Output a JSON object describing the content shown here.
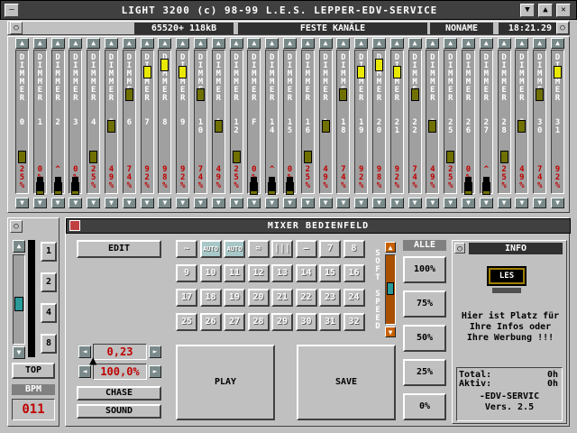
{
  "window": {
    "title": "LIGHT 3200 (c) 98-99 L.E.S. LEPPER-EDV-SERVICE",
    "menu_icon": "dash-icon",
    "btn_min": "▼",
    "btn_max": "▲",
    "btn_close": "✕"
  },
  "status": {
    "memory": "65520+ 118kB",
    "mode": "FESTE KANÄLE",
    "file": "NONAME",
    "time": "18:21.29"
  },
  "dimmer": {
    "label": "DIMMER",
    "up_arrow": "▲",
    "down_arrow": "▼",
    "channels": [
      {
        "num": "0",
        "pct": "25%",
        "level": 0.25
      },
      {
        "num": "1",
        "pct": "0%",
        "level": 0.0
      },
      {
        "num": "2",
        "pct": "^",
        "level": 0.0
      },
      {
        "num": "3",
        "pct": "0%",
        "level": 0.0
      },
      {
        "num": "4",
        "pct": "25%",
        "level": 0.25
      },
      {
        "num": "5",
        "pct": "49%",
        "level": 0.49
      },
      {
        "num": "6",
        "pct": "74%",
        "level": 0.74
      },
      {
        "num": "7",
        "pct": "92%",
        "level": 0.92
      },
      {
        "num": "8",
        "pct": "98%",
        "level": 0.98
      },
      {
        "num": "9",
        "pct": "92%",
        "level": 0.92
      },
      {
        "num": "10",
        "pct": "74%",
        "level": 0.74
      },
      {
        "num": "11",
        "pct": "49%",
        "level": 0.49
      },
      {
        "num": "12",
        "pct": "25%",
        "level": 0.25
      },
      {
        "num": "F",
        "pct": "0%",
        "level": 0.0
      },
      {
        "num": "14",
        "pct": "^",
        "level": 0.0
      },
      {
        "num": "15",
        "pct": "0%",
        "level": 0.0
      },
      {
        "num": "16",
        "pct": "25%",
        "level": 0.25
      },
      {
        "num": "17",
        "pct": "49%",
        "level": 0.49
      },
      {
        "num": "18",
        "pct": "74%",
        "level": 0.74
      },
      {
        "num": "19",
        "pct": "92%",
        "level": 0.92
      },
      {
        "num": "20",
        "pct": "98%",
        "level": 0.98
      },
      {
        "num": "21",
        "pct": "92%",
        "level": 0.92
      },
      {
        "num": "22",
        "pct": "74%",
        "level": 0.74
      },
      {
        "num": "24",
        "pct": "49%",
        "level": 0.49
      },
      {
        "num": "25",
        "pct": "25%",
        "level": 0.25
      },
      {
        "num": "26",
        "pct": "0%",
        "level": 0.0
      },
      {
        "num": "27",
        "pct": "^",
        "level": 0.0
      },
      {
        "num": "28",
        "pct": "25%",
        "level": 0.25
      },
      {
        "num": "29",
        "pct": "49%",
        "level": 0.49
      },
      {
        "num": "30",
        "pct": "74%",
        "level": 0.74
      },
      {
        "num": "31",
        "pct": "92%",
        "level": 0.92
      }
    ]
  },
  "left": {
    "pages": [
      "1",
      "2",
      "4",
      "8"
    ],
    "top_label": "TOP",
    "bpm_label": "BPM",
    "bpm_value": "011"
  },
  "mixer": {
    "title": "MIXER BEDIENFELD",
    "edit": "EDIT",
    "rate_value": "0,23",
    "percent_value": "100,0%",
    "chase": "CHASE",
    "sound": "SOUND",
    "play": "PLAY",
    "save": "SAVE",
    "soft": "SOFT",
    "speed": "SPEED",
    "alle": "ALLE",
    "presets": [
      "100%",
      "75%",
      "50%",
      "25%",
      "0%"
    ],
    "pattern_row1": [
      "~",
      "AUTO",
      "AUTO",
      "≈",
      "|||",
      "—",
      "7",
      "8"
    ],
    "grid": [
      "9",
      "10",
      "11",
      "12",
      "13",
      "14",
      "15",
      "16",
      "17",
      "18",
      "19",
      "20",
      "21",
      "22",
      "23",
      "24",
      "25",
      "26",
      "27",
      "28",
      "29",
      "30",
      "31",
      "32"
    ]
  },
  "info": {
    "title": "INFO",
    "logo": "LES",
    "text": "Hier ist Platz für Ihre Infos oder Ihre Werbung !!!",
    "total_label": "Total:",
    "total_value": "0h",
    "aktiv_label": "Aktiv:",
    "aktiv_value": "0h",
    "vendor": "-EDV-SERVIC",
    "version": "Vers. 2.5"
  }
}
